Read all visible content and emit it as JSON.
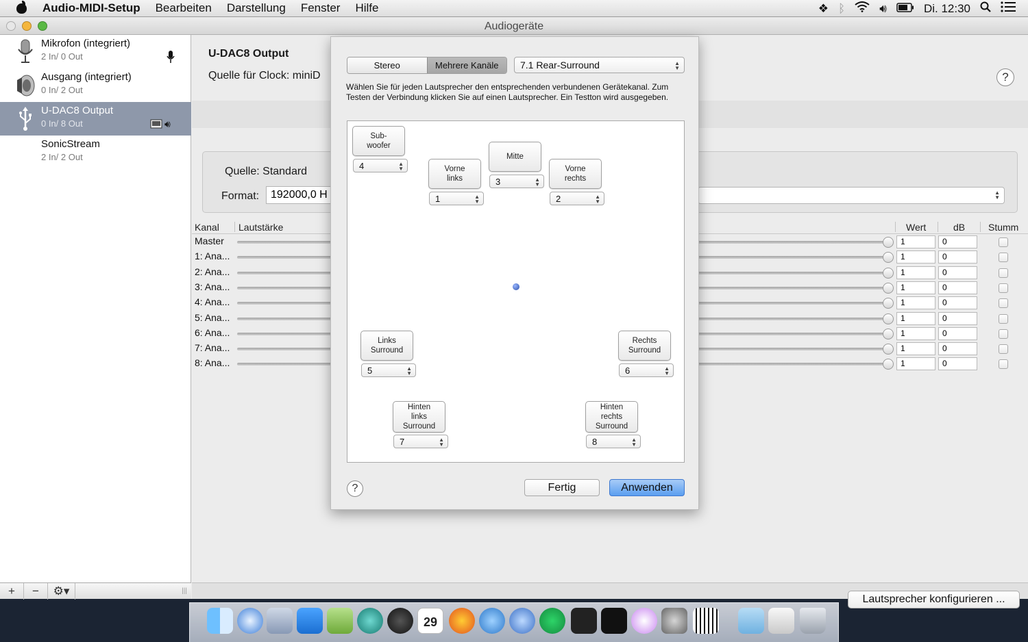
{
  "menubar": {
    "app_name": "Audio-MIDI-Setup",
    "menus": [
      "Bearbeiten",
      "Darstellung",
      "Fenster",
      "Hilfe"
    ],
    "clock": "Di. 12:30"
  },
  "window": {
    "title": "Audiogeräte"
  },
  "sidebar": {
    "devices": [
      {
        "name": "Mikrofon (integriert)",
        "io": "2 In/ 0 Out"
      },
      {
        "name": "Ausgang (integriert)",
        "io": "0 In/ 2 Out"
      },
      {
        "name": "U-DAC8 Output",
        "io": "0 In/ 8 Out"
      },
      {
        "name": "SonicStream",
        "io": "2 In/ 2 Out"
      }
    ],
    "add_label": "+",
    "remove_label": "−",
    "gear_label": "⚙▾",
    "resize_label": "|||"
  },
  "main": {
    "device_title": "U-DAC8 Output",
    "clock_source": "Quelle für Clock:  miniD",
    "help": "?",
    "source": "Quelle:  Standard",
    "format_label": "Format:",
    "format_value": "192000,0 H",
    "columns": {
      "kanal": "Kanal",
      "lautstaerke": "Lautstärke",
      "wert": "Wert",
      "db": "dB",
      "stumm": "Stumm"
    },
    "channels": [
      {
        "name": "Master",
        "wert": "1",
        "db": "0"
      },
      {
        "name": "1: Ana...",
        "wert": "1",
        "db": "0"
      },
      {
        "name": "2: Ana...",
        "wert": "1",
        "db": "0"
      },
      {
        "name": "3: Ana...",
        "wert": "1",
        "db": "0"
      },
      {
        "name": "4: Ana...",
        "wert": "1",
        "db": "0"
      },
      {
        "name": "5: Ana...",
        "wert": "1",
        "db": "0"
      },
      {
        "name": "6: Ana...",
        "wert": "1",
        "db": "0"
      },
      {
        "name": "7: Ana...",
        "wert": "1",
        "db": "0"
      },
      {
        "name": "8: Ana...",
        "wert": "1",
        "db": "0"
      }
    ],
    "configure_button": "Lautsprecher konfigurieren ..."
  },
  "sheet": {
    "tab_stereo": "Stereo",
    "tab_multi": "Mehrere Kanäle",
    "preset": "7.1 Rear-Surround",
    "instructions": "Wählen Sie für jeden Lautsprecher den entsprechenden verbundenen Gerätekanal. Zum Testen der Verbindung klicken Sie auf einen Lautsprecher. Ein Testton wird ausgegeben.",
    "speakers": {
      "subwoofer": {
        "label": "Sub-\nwoofer",
        "channel": "4"
      },
      "front_left": {
        "label": "Vorne\nlinks",
        "channel": "1"
      },
      "center": {
        "label": "Mitte",
        "channel": "3"
      },
      "front_right": {
        "label": "Vorne\nrechts",
        "channel": "2"
      },
      "left_surround": {
        "label": "Links\nSurround",
        "channel": "5"
      },
      "right_surround": {
        "label": "Rechts\nSurround",
        "channel": "6"
      },
      "rear_left_surround": {
        "label": "Hinten\nlinks\nSurround",
        "channel": "7"
      },
      "rear_right_surround": {
        "label": "Hinten\nrechts\nSurround",
        "channel": "8"
      }
    },
    "help": "?",
    "done_button": "Fertig",
    "apply_button": "Anwenden"
  },
  "dock": {
    "calendar_day": "29",
    "apps": [
      "finder-icon",
      "safari-icon",
      "preview-icon",
      "dropbox-icon",
      "music-score-icon",
      "calibre-icon",
      "font-book-icon",
      "calendar-icon",
      "firefox-icon",
      "tweet-icon",
      "navigation-icon",
      "spotify-icon",
      "equalizer-icon",
      "tidal-icon",
      "itunes-icon",
      "system-preferences-icon",
      "audio-midi-icon",
      "folder-icon",
      "screen-icon",
      "trash-icon"
    ]
  }
}
